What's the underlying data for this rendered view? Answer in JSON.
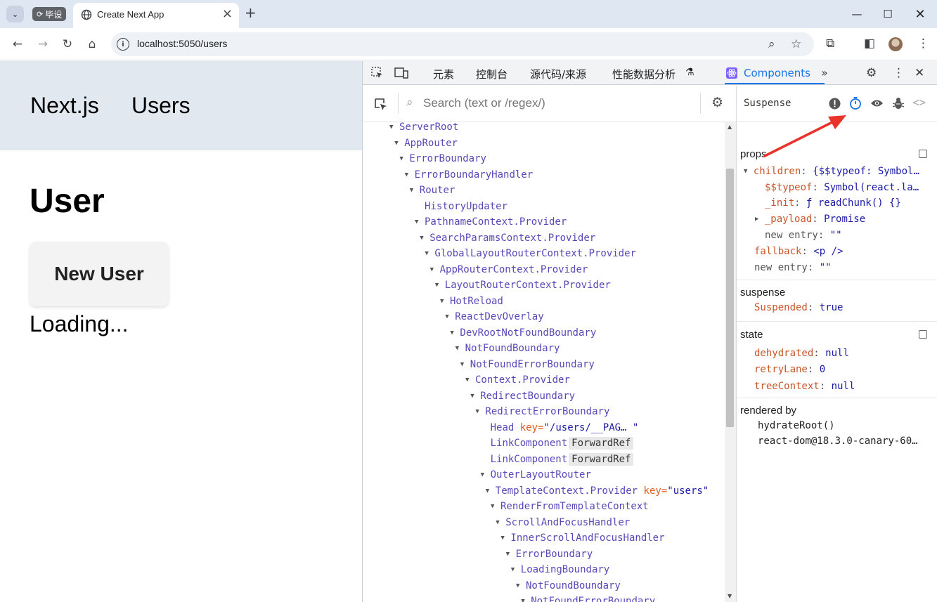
{
  "browser": {
    "group_chip_label": "毕设",
    "tab_title": "Create Next App",
    "url": "localhost:5050/users"
  },
  "page": {
    "nav": {
      "brand": "Next.js",
      "users_link": "Users"
    },
    "heading": "User",
    "new_user_button": "New User",
    "loading_text": "Loading..."
  },
  "devtools": {
    "tabs": [
      "元素",
      "控制台",
      "源代码/来源",
      "性能数据分析"
    ],
    "components_tab": "Components",
    "search_placeholder": "Search (text or /regex/)",
    "tree": [
      {
        "depth": 0,
        "name": "ServerRoot",
        "expanded": true
      },
      {
        "depth": 1,
        "name": "AppRouter",
        "expanded": true
      },
      {
        "depth": 2,
        "name": "ErrorBoundary",
        "expanded": true
      },
      {
        "depth": 3,
        "name": "ErrorBoundaryHandler",
        "expanded": true
      },
      {
        "depth": 4,
        "name": "Router",
        "expanded": true
      },
      {
        "depth": 5,
        "name": "HistoryUpdater",
        "expanded": false
      },
      {
        "depth": 5,
        "name": "PathnameContext.Provider",
        "expanded": true
      },
      {
        "depth": 6,
        "name": "SearchParamsContext.Provider",
        "expanded": true
      },
      {
        "depth": 7,
        "name": "GlobalLayoutRouterContext.Provider",
        "expanded": true
      },
      {
        "depth": 8,
        "name": "AppRouterContext.Provider",
        "expanded": true
      },
      {
        "depth": 9,
        "name": "LayoutRouterContext.Provider",
        "expanded": true
      },
      {
        "depth": 10,
        "name": "HotReload",
        "expanded": true
      },
      {
        "depth": 11,
        "name": "ReactDevOverlay",
        "expanded": true
      },
      {
        "depth": 12,
        "name": "DevRootNotFoundBoundary",
        "expanded": true
      },
      {
        "depth": 13,
        "name": "NotFoundBoundary",
        "expanded": true
      },
      {
        "depth": 14,
        "name": "NotFoundErrorBoundary",
        "expanded": true
      },
      {
        "depth": 15,
        "name": "Context.Provider",
        "expanded": true
      },
      {
        "depth": 16,
        "name": "RedirectBoundary",
        "expanded": true
      },
      {
        "depth": 17,
        "name": "RedirectErrorBoundary",
        "expanded": true
      },
      {
        "depth": 18,
        "name": "Head",
        "expanded": false,
        "key": "\"/users/__PAG… \""
      },
      {
        "depth": 18,
        "name": "LinkComponent",
        "expanded": false,
        "badge": "ForwardRef"
      },
      {
        "depth": 18,
        "name": "LinkComponent",
        "expanded": false,
        "badge": "ForwardRef"
      },
      {
        "depth": 18,
        "name": "OuterLayoutRouter",
        "expanded": true
      },
      {
        "depth": 19,
        "name": "TemplateContext.Provider",
        "expanded": true,
        "key": "\"users\""
      },
      {
        "depth": 20,
        "name": "RenderFromTemplateContext",
        "expanded": true
      },
      {
        "depth": 21,
        "name": "ScrollAndFocusHandler",
        "expanded": true
      },
      {
        "depth": 22,
        "name": "InnerScrollAndFocusHandler",
        "expanded": true
      },
      {
        "depth": 23,
        "name": "ErrorBoundary",
        "expanded": true
      },
      {
        "depth": 24,
        "name": "LoadingBoundary",
        "expanded": true
      },
      {
        "depth": 25,
        "name": "NotFoundBoundary",
        "expanded": true
      },
      {
        "depth": 26,
        "name": "NotFoundErrorBoundary",
        "expanded": true
      }
    ],
    "key_attr": "key",
    "inspector": {
      "title": "Suspense",
      "props_title": "props",
      "props": {
        "children_key": "children",
        "children_val": "{$$typeof: Symbol…",
        "typeof_key": "$$typeof",
        "typeof_val": "Symbol(react.la…",
        "init_key": "_init",
        "init_val": "ƒ readChunk() {}",
        "payload_key": "_payload",
        "payload_val": "Promise",
        "new_entry_1": "new entry",
        "new_entry_1_val": "\"\"",
        "fallback_key": "fallback",
        "fallback_val": "<p />",
        "new_entry_2": "new entry",
        "new_entry_2_val": "\"\""
      },
      "suspense_title": "suspense",
      "suspended_key": "Suspended",
      "suspended_val": "true",
      "state_title": "state",
      "state": {
        "dehydrated_key": "dehydrated",
        "dehydrated_val": "null",
        "retrylane_key": "retryLane",
        "retrylane_val": "0",
        "treecontext_key": "treeContext",
        "treecontext_val": "null"
      },
      "rendered_by_title": "rendered by",
      "rendered_by": [
        "hydrateRoot()",
        "react-dom@18.3.0-canary-60…"
      ]
    }
  },
  "colors": {
    "accent": "#1a73e8",
    "annotation_arrow": "#e8332a",
    "component_name": "#5a47b8",
    "prop_key": "#c8562b"
  }
}
